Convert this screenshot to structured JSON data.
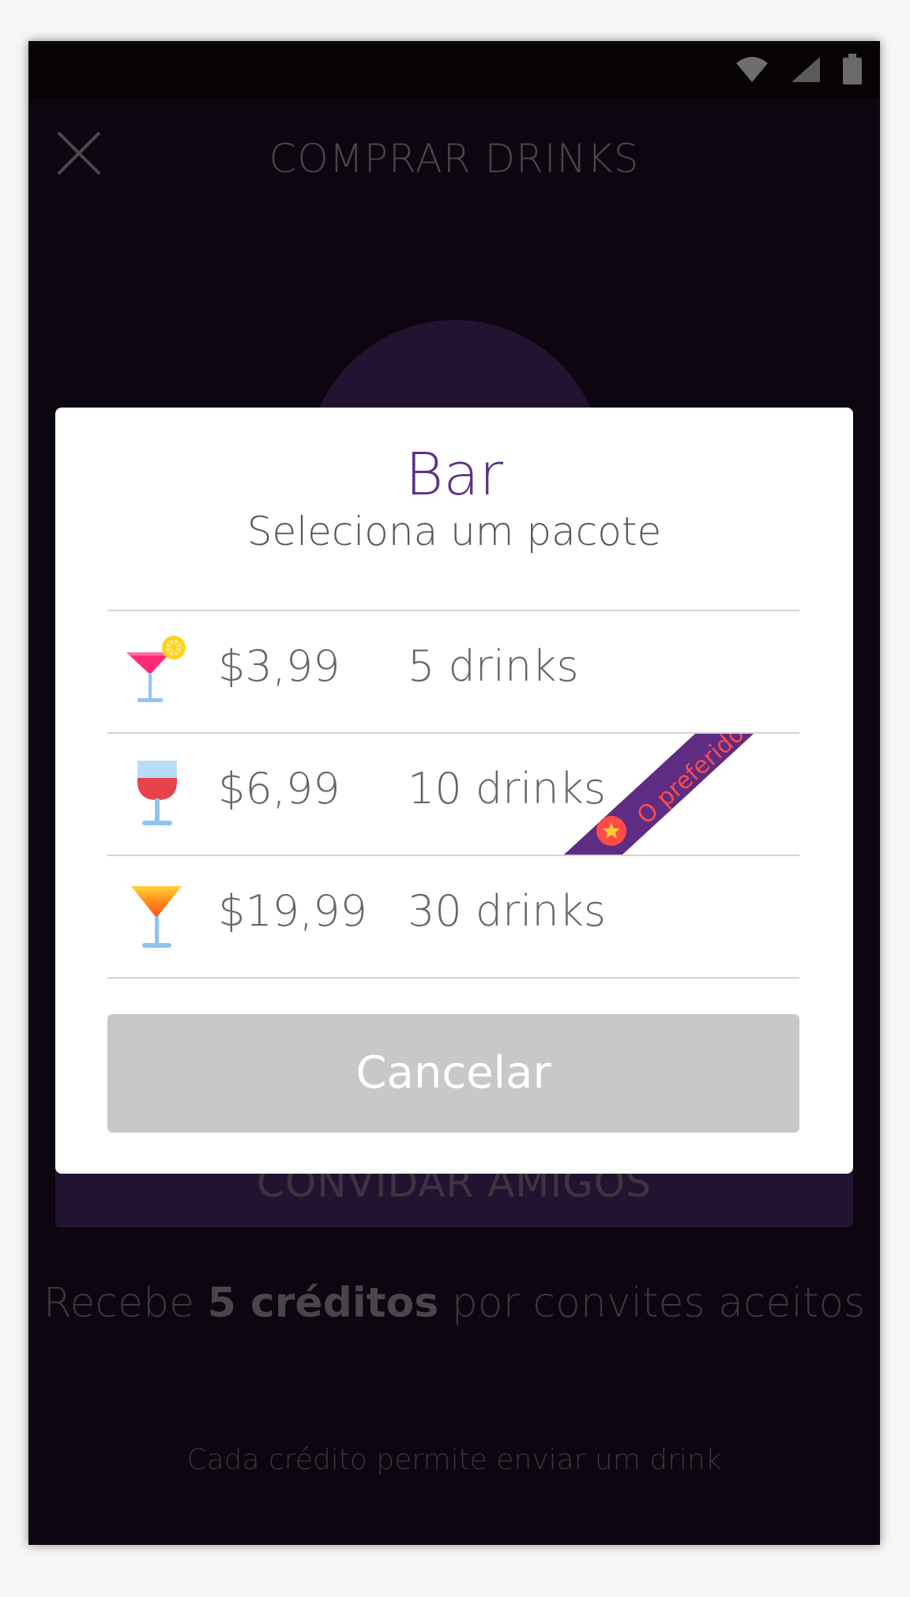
{
  "app": {
    "title": "COMPRAR DRINKS",
    "invite_button": "CONVIDAR AMIGOS",
    "credits_prefix": "Recebe",
    "credits_bold": "5 créditos",
    "credits_suffix": "por convites aceitos",
    "footnote": "Cada crédito permite enviar um drink"
  },
  "modal": {
    "title": "Bar",
    "subtitle": "Seleciona um pacote",
    "packages": [
      {
        "price": "$3,99",
        "drinks": "5 drinks",
        "icon": "cocktail-glass-icon"
      },
      {
        "price": "$6,99",
        "drinks": "10 drinks",
        "icon": "wine-glass-icon",
        "badge": "O preferido"
      },
      {
        "price": "$19,99",
        "drinks": "30 drinks",
        "icon": "tropical-drink-icon"
      }
    ],
    "cancel_label": "Cancelar"
  },
  "colors": {
    "accent": "#5d3287",
    "ribbon": "#5e2c82",
    "ribbon_text": "#ff4a4a",
    "overlay_bg": "#0d050f",
    "cancel_bg": "#c8c8c8"
  },
  "status_icons": [
    "wifi-icon",
    "signal-icon",
    "battery-icon"
  ]
}
